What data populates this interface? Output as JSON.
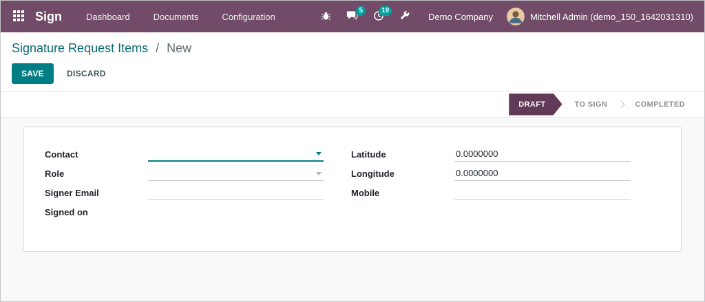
{
  "navbar": {
    "app_name": "Sign",
    "menu_items": [
      {
        "label": "Dashboard"
      },
      {
        "label": "Documents"
      },
      {
        "label": "Configuration"
      }
    ],
    "icons": [
      {
        "name": "apps-grid-icon"
      },
      {
        "name": "debug-bug-icon"
      },
      {
        "name": "messages-icon",
        "badge": "5"
      },
      {
        "name": "activities-clock-icon",
        "badge": "19"
      },
      {
        "name": "tools-icon"
      }
    ],
    "company": "Demo Company",
    "user": "Mitchell Admin (demo_150_1642031310)"
  },
  "breadcrumb": {
    "parent": "Signature Request Items",
    "separator": "/",
    "current": "New"
  },
  "actions": {
    "save_label": "SAVE",
    "discard_label": "DISCARD"
  },
  "statusbar": {
    "steps": [
      {
        "label": "DRAFT",
        "active": true
      },
      {
        "label": "TO SIGN",
        "active": false
      },
      {
        "label": "COMPLETED",
        "active": false
      }
    ]
  },
  "form": {
    "left_fields": [
      {
        "label": "Contact",
        "value": "",
        "type": "many2one",
        "focused": true
      },
      {
        "label": "Role",
        "value": "",
        "type": "many2one",
        "focused": false
      },
      {
        "label": "Signer Email",
        "value": "",
        "type": "text"
      },
      {
        "label": "Signed on",
        "value": "",
        "type": "readonly"
      }
    ],
    "right_fields": [
      {
        "label": "Latitude",
        "value": "0.0000000",
        "type": "float"
      },
      {
        "label": "Longitude",
        "value": "0.0000000",
        "type": "float"
      },
      {
        "label": "Mobile",
        "value": "",
        "type": "text"
      }
    ]
  },
  "colors": {
    "navbar_bg": "#714B67",
    "primary_teal": "#017E84",
    "badge_bg": "#00A09D",
    "draft_step_bg": "#603A56",
    "breadcrumb_link": "#0B6A72"
  }
}
